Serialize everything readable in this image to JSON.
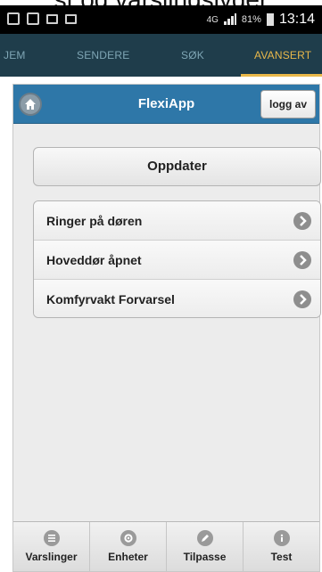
{
  "caption_text": "st og varslingslyder",
  "status_bar": {
    "network": "4G",
    "battery": "81%",
    "time": "13:14"
  },
  "tabs": [
    {
      "label": "JEM",
      "active": false
    },
    {
      "label": "SENDERE",
      "active": false
    },
    {
      "label": "SØK",
      "active": false
    },
    {
      "label": "AVANSERT",
      "active": true
    }
  ],
  "app": {
    "title": "FlexiApp",
    "logout_label": "logg av",
    "update_label": "Oppdater",
    "list_items": [
      {
        "label": "Ringer på døren"
      },
      {
        "label": "Hoveddør åpnet"
      },
      {
        "label": "Komfyrvakt Forvarsel"
      }
    ]
  },
  "bottom_nav": [
    {
      "label": "Varslinger",
      "icon": "list-icon"
    },
    {
      "label": "Enheter",
      "icon": "gear-icon"
    },
    {
      "label": "Tilpasse",
      "icon": "pencil-icon"
    },
    {
      "label": "Test",
      "icon": "info-icon"
    }
  ],
  "colors": {
    "tabbar_bg": "#1f3d4b",
    "tab_active": "#e9b84a",
    "app_header": "#2e77a8"
  }
}
